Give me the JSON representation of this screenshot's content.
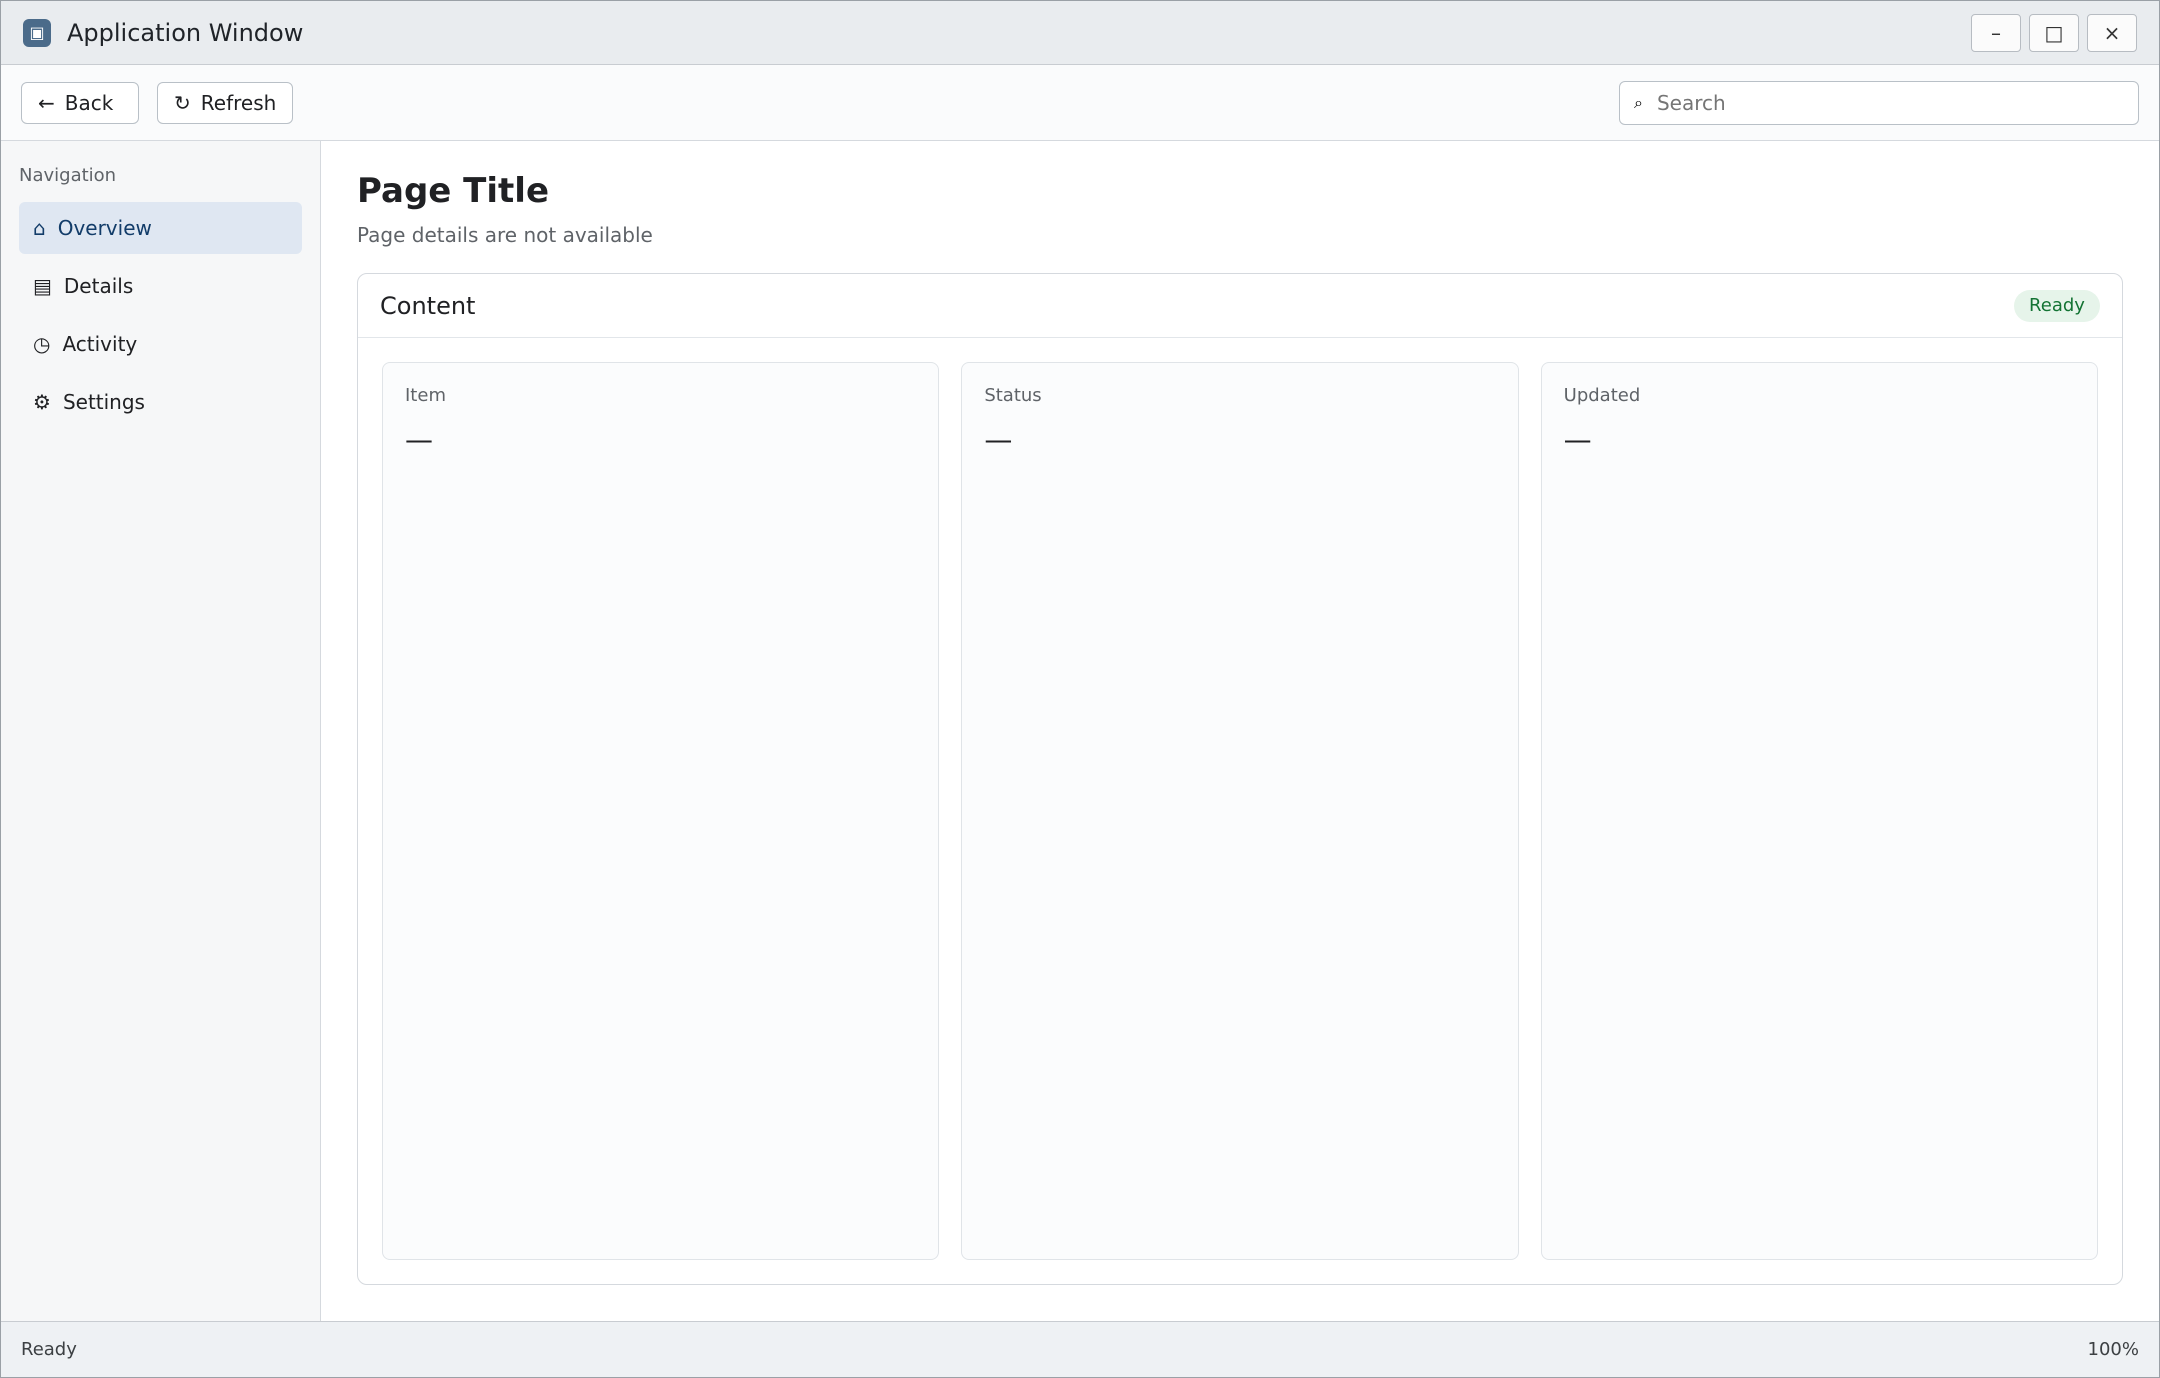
{
  "window": {
    "title": "Application Window",
    "minimize_label": "–",
    "maximize_label": "□",
    "close_label": "×"
  },
  "toolbar": {
    "back_label": "Back",
    "refresh_label": "Refresh",
    "search_placeholder": "Search",
    "search_value": ""
  },
  "sidebar": {
    "heading": "Navigation",
    "items": [
      {
        "label": "Overview"
      },
      {
        "label": "Details"
      },
      {
        "label": "Activity"
      },
      {
        "label": "Settings"
      }
    ]
  },
  "main": {
    "title": "Page Title",
    "subtitle": "Page details are not available",
    "panel_title": "Content",
    "status": "Ready",
    "cards": [
      {
        "label": "Item",
        "value": "—"
      },
      {
        "label": "Status",
        "value": "—"
      },
      {
        "label": "Updated",
        "value": "—"
      }
    ]
  },
  "statusbar": {
    "left_text": "Ready",
    "right_text": "100%"
  },
  "colors": {
    "accent": "#4b6b8a",
    "status_ok": "#137333"
  }
}
